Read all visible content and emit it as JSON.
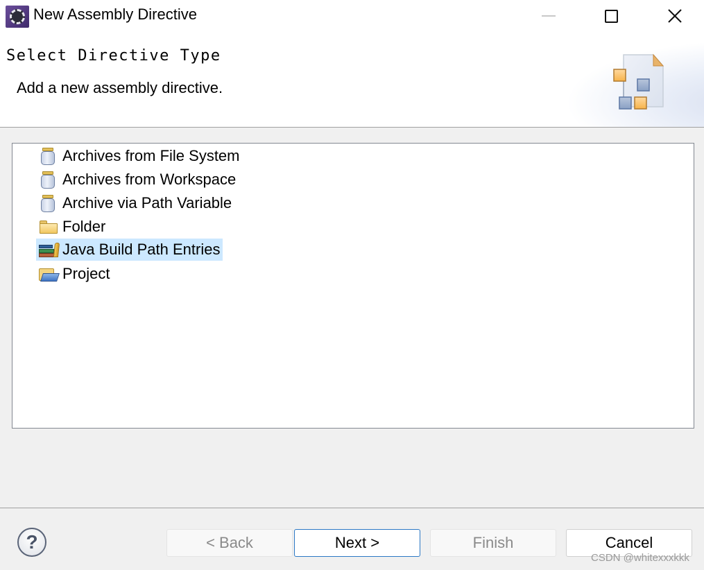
{
  "window": {
    "title": "New Assembly Directive",
    "icon": "eclipse-gear-icon",
    "controls": {
      "minimize": "minimize-icon",
      "maximize": "maximize-icon",
      "close": "close-icon"
    },
    "close_glyph": "✕"
  },
  "header": {
    "title": "Select Directive Type",
    "description": "Add a new assembly directive.",
    "image": "wizard-banner-icon"
  },
  "tree": {
    "items": [
      {
        "label": "Archives from File System",
        "icon": "jar-icon",
        "selected": false
      },
      {
        "label": "Archives from Workspace",
        "icon": "jar-icon",
        "selected": false
      },
      {
        "label": "Archive via Path Variable",
        "icon": "jar-icon",
        "selected": false
      },
      {
        "label": "Folder",
        "icon": "folder-icon",
        "selected": false
      },
      {
        "label": "Java Build Path Entries",
        "icon": "library-books-icon",
        "selected": true
      },
      {
        "label": "Project",
        "icon": "open-folder-icon",
        "selected": false
      }
    ]
  },
  "footer": {
    "help_glyph": "?",
    "back_label": "< Back",
    "next_label": "Next >",
    "finish_label": "Finish",
    "cancel_label": "Cancel",
    "back_enabled": false,
    "finish_enabled": false
  },
  "watermark": "CSDN @whitexxxkkk",
  "colors": {
    "selection": "#cce8ff",
    "default_button_border": "#2b78c5",
    "disabled_text": "#8a8a8a"
  }
}
